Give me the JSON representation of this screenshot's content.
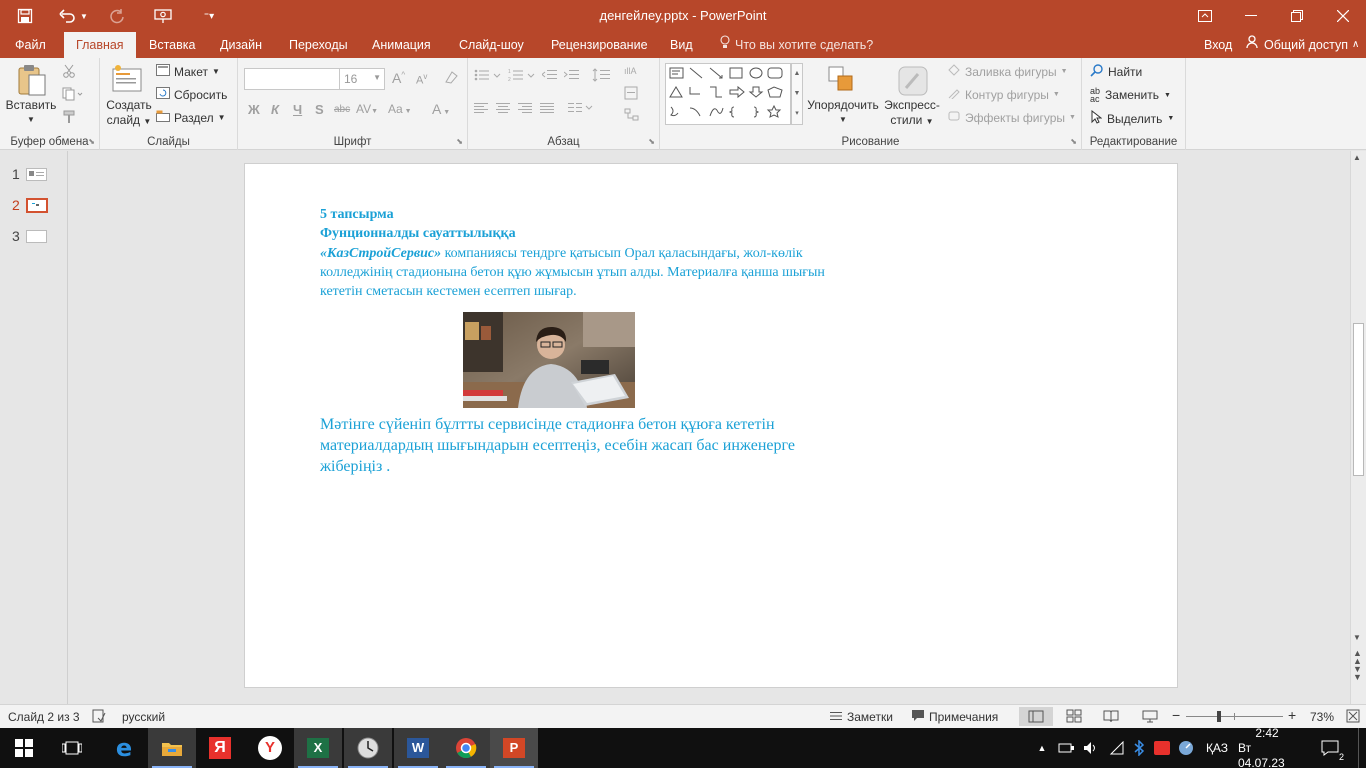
{
  "window": {
    "title": "денгейлеу.pptx - PowerPoint",
    "accent_color": "#b7472a"
  },
  "quick_access": {
    "save_icon": "save-icon",
    "undo_icon": "undo-icon",
    "redo_icon": "redo-icon",
    "present_icon": "present-from-beginning-icon",
    "customize_icon": "customize-toolbar-icon"
  },
  "tabs": {
    "file": "Файл",
    "home": "Главная",
    "insert": "Вставка",
    "design": "Дизайн",
    "transitions": "Переходы",
    "animation": "Анимация",
    "slideshow": "Слайд-шоу",
    "review": "Рецензирование",
    "view": "Вид",
    "tell_me": "Что вы хотите сделать?",
    "login": "Вход",
    "share": "Общий доступ"
  },
  "ribbon": {
    "clipboard": {
      "paste": "Вставить",
      "label": "Буфер обмена"
    },
    "slides": {
      "new_slide_line1": "Создать",
      "new_slide_line2": "слайд",
      "layout": "Макет",
      "reset": "Сбросить",
      "section": "Раздел",
      "label": "Слайды"
    },
    "font": {
      "font_name": "",
      "font_size": "16",
      "bold": "Ж",
      "italic": "К",
      "underline": "Ч",
      "shadow": "S",
      "strike": "abc",
      "spacing": "AV",
      "case": "Aa",
      "color": "A",
      "grow": "A",
      "shrink": "A",
      "label": "Шрифт"
    },
    "paragraph": {
      "label": "Абзац"
    },
    "drawing": {
      "arrange": "Упорядочить",
      "quick_styles_line1": "Экспресс-",
      "quick_styles_line2": "стили",
      "shape_fill": "Заливка фигуры",
      "shape_outline": "Контур фигуры",
      "shape_effects": "Эффекты фигуры",
      "label": "Рисование"
    },
    "editing": {
      "find": "Найти",
      "replace": "Заменить",
      "select": "Выделить",
      "label": "Редактирование"
    }
  },
  "thumbnails": [
    {
      "number": "1"
    },
    {
      "number": "2"
    },
    {
      "number": "3"
    }
  ],
  "slide": {
    "task_title": "5 тапсырма",
    "subtitle": "Фунционналды сауаттылыққа",
    "company": "«КазСтройСервис»",
    "para1_rest": " компаниясы тендрге қатысып Орал қаласындағы, жол-көлік",
    "para1_line2": "колледжінің стадионына бетон құю жұмысын ұтып алды. Материалға қанша шығын",
    "para1_line3": "кететін сметасын кестемен есептеп шығар.",
    "para2_line1": "Мәтінге сүйеніп бұлтты сервисінде стадионға бетон құюға  кететін",
    "para2_line2": "материалдардың шығындарын есептеңіз, есебін жасап бас инженерге",
    "para2_line3": "жіберіңіз .",
    "text_color": "#1ba1d6"
  },
  "statusbar": {
    "slide_info": "Слайд 2 из 3",
    "language": "русский",
    "notes": "Заметки",
    "comments": "Примечания",
    "zoom": "73%"
  },
  "taskbar": {
    "language": "ҚАЗ",
    "time": "2:42",
    "date": "Вт 04.07.23",
    "notifications": "2"
  }
}
